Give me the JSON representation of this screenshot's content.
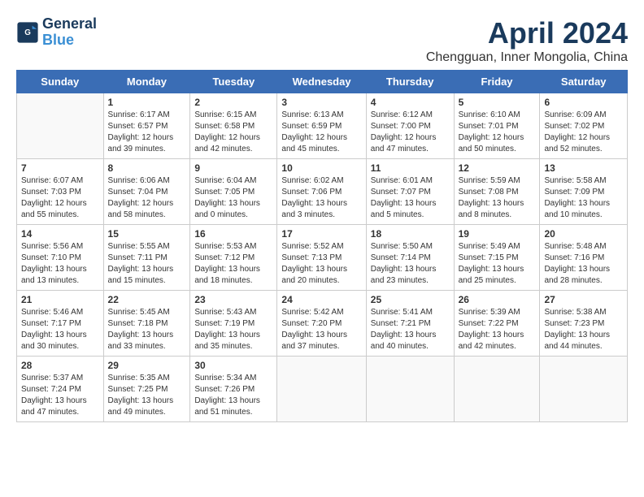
{
  "app": {
    "name_line1": "General",
    "name_line2": "Blue"
  },
  "header": {
    "month": "April 2024",
    "location": "Chengguan, Inner Mongolia, China"
  },
  "weekdays": [
    "Sunday",
    "Monday",
    "Tuesday",
    "Wednesday",
    "Thursday",
    "Friday",
    "Saturday"
  ],
  "weeks": [
    [
      {
        "day": "",
        "info": ""
      },
      {
        "day": "1",
        "info": "Sunrise: 6:17 AM\nSunset: 6:57 PM\nDaylight: 12 hours\nand 39 minutes."
      },
      {
        "day": "2",
        "info": "Sunrise: 6:15 AM\nSunset: 6:58 PM\nDaylight: 12 hours\nand 42 minutes."
      },
      {
        "day": "3",
        "info": "Sunrise: 6:13 AM\nSunset: 6:59 PM\nDaylight: 12 hours\nand 45 minutes."
      },
      {
        "day": "4",
        "info": "Sunrise: 6:12 AM\nSunset: 7:00 PM\nDaylight: 12 hours\nand 47 minutes."
      },
      {
        "day": "5",
        "info": "Sunrise: 6:10 AM\nSunset: 7:01 PM\nDaylight: 12 hours\nand 50 minutes."
      },
      {
        "day": "6",
        "info": "Sunrise: 6:09 AM\nSunset: 7:02 PM\nDaylight: 12 hours\nand 52 minutes."
      }
    ],
    [
      {
        "day": "7",
        "info": "Sunrise: 6:07 AM\nSunset: 7:03 PM\nDaylight: 12 hours\nand 55 minutes."
      },
      {
        "day": "8",
        "info": "Sunrise: 6:06 AM\nSunset: 7:04 PM\nDaylight: 12 hours\nand 58 minutes."
      },
      {
        "day": "9",
        "info": "Sunrise: 6:04 AM\nSunset: 7:05 PM\nDaylight: 13 hours\nand 0 minutes."
      },
      {
        "day": "10",
        "info": "Sunrise: 6:02 AM\nSunset: 7:06 PM\nDaylight: 13 hours\nand 3 minutes."
      },
      {
        "day": "11",
        "info": "Sunrise: 6:01 AM\nSunset: 7:07 PM\nDaylight: 13 hours\nand 5 minutes."
      },
      {
        "day": "12",
        "info": "Sunrise: 5:59 AM\nSunset: 7:08 PM\nDaylight: 13 hours\nand 8 minutes."
      },
      {
        "day": "13",
        "info": "Sunrise: 5:58 AM\nSunset: 7:09 PM\nDaylight: 13 hours\nand 10 minutes."
      }
    ],
    [
      {
        "day": "14",
        "info": "Sunrise: 5:56 AM\nSunset: 7:10 PM\nDaylight: 13 hours\nand 13 minutes."
      },
      {
        "day": "15",
        "info": "Sunrise: 5:55 AM\nSunset: 7:11 PM\nDaylight: 13 hours\nand 15 minutes."
      },
      {
        "day": "16",
        "info": "Sunrise: 5:53 AM\nSunset: 7:12 PM\nDaylight: 13 hours\nand 18 minutes."
      },
      {
        "day": "17",
        "info": "Sunrise: 5:52 AM\nSunset: 7:13 PM\nDaylight: 13 hours\nand 20 minutes."
      },
      {
        "day": "18",
        "info": "Sunrise: 5:50 AM\nSunset: 7:14 PM\nDaylight: 13 hours\nand 23 minutes."
      },
      {
        "day": "19",
        "info": "Sunrise: 5:49 AM\nSunset: 7:15 PM\nDaylight: 13 hours\nand 25 minutes."
      },
      {
        "day": "20",
        "info": "Sunrise: 5:48 AM\nSunset: 7:16 PM\nDaylight: 13 hours\nand 28 minutes."
      }
    ],
    [
      {
        "day": "21",
        "info": "Sunrise: 5:46 AM\nSunset: 7:17 PM\nDaylight: 13 hours\nand 30 minutes."
      },
      {
        "day": "22",
        "info": "Sunrise: 5:45 AM\nSunset: 7:18 PM\nDaylight: 13 hours\nand 33 minutes."
      },
      {
        "day": "23",
        "info": "Sunrise: 5:43 AM\nSunset: 7:19 PM\nDaylight: 13 hours\nand 35 minutes."
      },
      {
        "day": "24",
        "info": "Sunrise: 5:42 AM\nSunset: 7:20 PM\nDaylight: 13 hours\nand 37 minutes."
      },
      {
        "day": "25",
        "info": "Sunrise: 5:41 AM\nSunset: 7:21 PM\nDaylight: 13 hours\nand 40 minutes."
      },
      {
        "day": "26",
        "info": "Sunrise: 5:39 AM\nSunset: 7:22 PM\nDaylight: 13 hours\nand 42 minutes."
      },
      {
        "day": "27",
        "info": "Sunrise: 5:38 AM\nSunset: 7:23 PM\nDaylight: 13 hours\nand 44 minutes."
      }
    ],
    [
      {
        "day": "28",
        "info": "Sunrise: 5:37 AM\nSunset: 7:24 PM\nDaylight: 13 hours\nand 47 minutes."
      },
      {
        "day": "29",
        "info": "Sunrise: 5:35 AM\nSunset: 7:25 PM\nDaylight: 13 hours\nand 49 minutes."
      },
      {
        "day": "30",
        "info": "Sunrise: 5:34 AM\nSunset: 7:26 PM\nDaylight: 13 hours\nand 51 minutes."
      },
      {
        "day": "",
        "info": ""
      },
      {
        "day": "",
        "info": ""
      },
      {
        "day": "",
        "info": ""
      },
      {
        "day": "",
        "info": ""
      }
    ]
  ]
}
